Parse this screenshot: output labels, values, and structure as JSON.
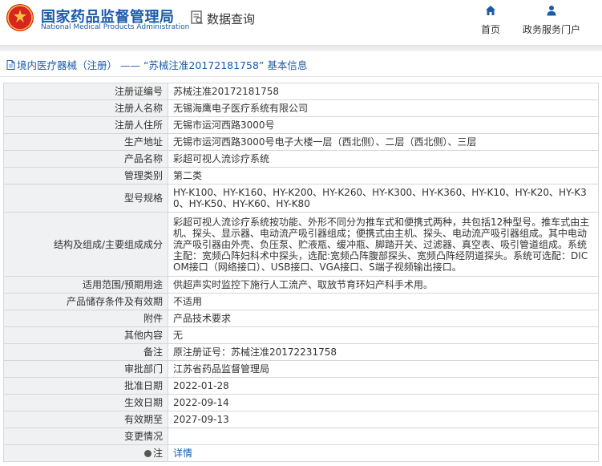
{
  "header": {
    "logo_cn": "国家药品监督管理局",
    "logo_en": "National Medical Products Administration",
    "data_query": "数据查询",
    "nav": [
      {
        "label": "首页",
        "icon": "home-icon"
      },
      {
        "label": "政务服务门户",
        "icon": "user-icon"
      }
    ]
  },
  "breadcrumb": {
    "text": "境内医疗器械（注册） —— “苏械注准20172181758” 基本信息"
  },
  "colors": {
    "brand_blue": "#1a5ba8",
    "emblem_red": "#d8251f",
    "label_bg": "#f0f1f2",
    "border": "#d3d7dc"
  },
  "rows": [
    {
      "label": "注册证编号",
      "value": "苏械注准20172181758"
    },
    {
      "label": "注册人名称",
      "value": "无锡海鹰电子医疗系统有限公司"
    },
    {
      "label": "注册人住所",
      "value": "无锡市运河西路3000号"
    },
    {
      "label": "生产地址",
      "value": "无锡市运河西路3000号电子大楼一层（西北侧）、二层（西北侧）、三层"
    },
    {
      "label": "产品名称",
      "value": "彩超可视人流诊疗系统"
    },
    {
      "label": "管理类别",
      "value": "第二类"
    },
    {
      "label": "型号规格",
      "value": "HY-K100、HY-K160、HY-K200、HY-K260、HY-K300、HY-K360、HY-K10、HY-K20、HY-K30、HY-K50、HY-K60、HY-K80"
    },
    {
      "label": "结构及组成/主要组成成分",
      "value": "彩超可视人流诊疗系统按功能、外形不同分为推车式和便携式两种，共包括12种型号。推车式由主机、探头、显示器、电动流产吸引器组成；便携式由主机、探头、电动流产吸引器组成。其中电动流产吸引器由外壳、负压泵、贮液瓶、缓冲瓶、脚踏开关、过滤器、真空表、吸引管道组成。系统主配：宽频凸阵妇科术中探头，选配:宽频凸阵腹部探头、宽频凸阵经阴道探头。系统可选配：DICOM接口（网络接口）、USB接口、VGA接口、S端子视频输出接口。"
    },
    {
      "label": "适用范围/预期用途",
      "value": "供超声实时监控下施行人工流产、取放节育环妇产科手术用。"
    },
    {
      "label": "产品储存条件及有效期",
      "value": "不适用"
    },
    {
      "label": "附件",
      "value": "产品技术要求"
    },
    {
      "label": "其他内容",
      "value": "无"
    },
    {
      "label": "备注",
      "value": "原注册证号：苏械注准20172231758"
    },
    {
      "label": "审批部门",
      "value": "江苏省药品监督管理局"
    },
    {
      "label": "批准日期",
      "value": "2022-01-28"
    },
    {
      "label": "生效日期",
      "value": "2022-09-14"
    },
    {
      "label": "有效期至",
      "value": "2027-09-13"
    },
    {
      "label": "变更情况",
      "value": ""
    }
  ],
  "note_row": {
    "label": "注",
    "link": "详情"
  }
}
